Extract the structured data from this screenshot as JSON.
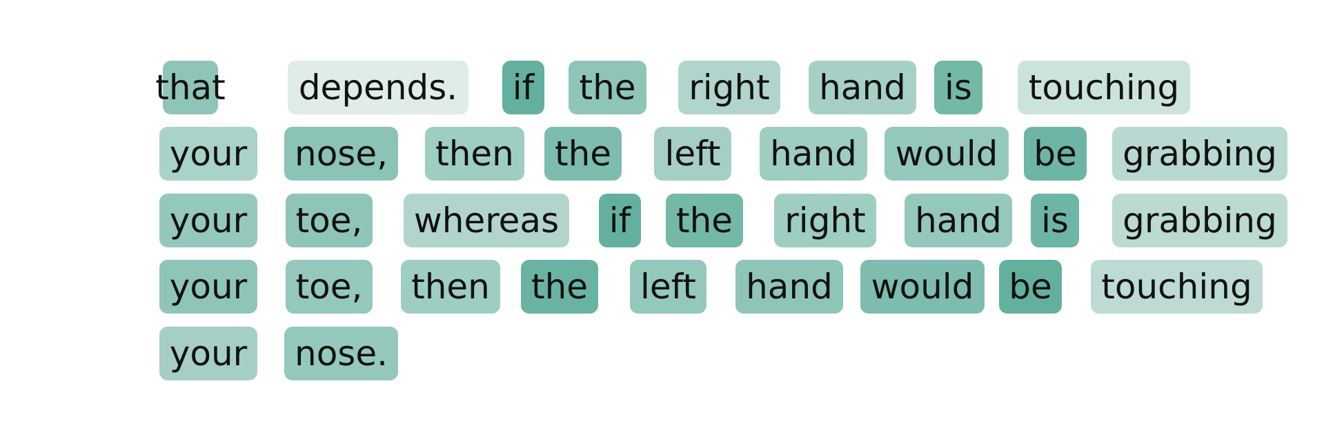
{
  "tokens": [
    {
      "text": "that",
      "weight": 0.62
    },
    {
      "text": "depends.",
      "weight": 0.1
    },
    {
      "text": "if",
      "weight": 0.9
    },
    {
      "text": "the",
      "weight": 0.62
    },
    {
      "text": "right",
      "weight": 0.4
    },
    {
      "text": "hand",
      "weight": 0.47
    },
    {
      "text": "is",
      "weight": 0.8
    },
    {
      "text": "touching",
      "weight": 0.22
    },
    {
      "text": "your",
      "weight": 0.45
    },
    {
      "text": "nose,",
      "weight": 0.65
    },
    {
      "text": "then",
      "weight": 0.52
    },
    {
      "text": "the",
      "weight": 0.74
    },
    {
      "text": "left",
      "weight": 0.48
    },
    {
      "text": "hand",
      "weight": 0.52
    },
    {
      "text": "would",
      "weight": 0.58
    },
    {
      "text": "be",
      "weight": 0.84
    },
    {
      "text": "grabbing",
      "weight": 0.35
    },
    {
      "text": "your",
      "weight": 0.58
    },
    {
      "text": "toe,",
      "weight": 0.62
    },
    {
      "text": "whereas",
      "weight": 0.4
    },
    {
      "text": "if",
      "weight": 0.9
    },
    {
      "text": "the",
      "weight": 0.8
    },
    {
      "text": "right",
      "weight": 0.52
    },
    {
      "text": "hand",
      "weight": 0.58
    },
    {
      "text": "is",
      "weight": 0.84
    },
    {
      "text": "grabbing",
      "weight": 0.34
    },
    {
      "text": "your",
      "weight": 0.62
    },
    {
      "text": "toe,",
      "weight": 0.58
    },
    {
      "text": "then",
      "weight": 0.52
    },
    {
      "text": "the",
      "weight": 0.86
    },
    {
      "text": "left",
      "weight": 0.58
    },
    {
      "text": "hand",
      "weight": 0.62
    },
    {
      "text": "would",
      "weight": 0.74
    },
    {
      "text": "be",
      "weight": 0.9
    },
    {
      "text": "touching",
      "weight": 0.32
    },
    {
      "text": "your",
      "weight": 0.48
    },
    {
      "text": "nose.",
      "weight": 0.58
    }
  ],
  "colors": {
    "low": "#eef3f1",
    "high": "#55a996",
    "text": "#111111"
  }
}
